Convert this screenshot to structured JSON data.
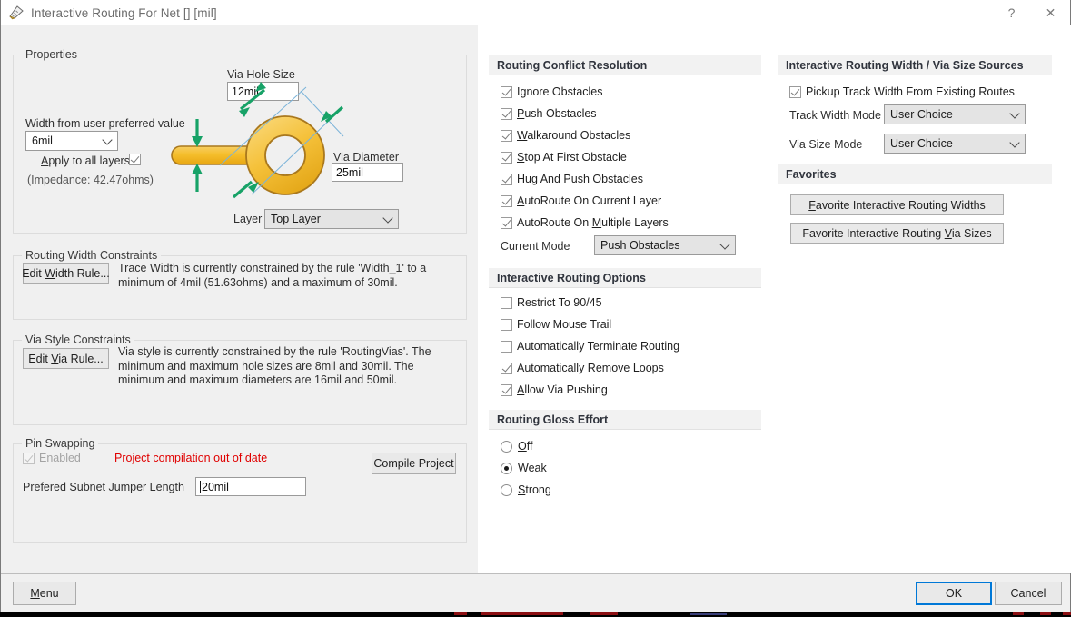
{
  "window": {
    "title": "Interactive Routing For Net [] [mil]",
    "icon": "routing-icon",
    "help_button": "?",
    "close_button": "✕"
  },
  "left_panel": {
    "properties": {
      "legend": "Properties",
      "via_hole_size_label": "Via Hole Size",
      "via_hole_size_value": "12mil",
      "width_label": "Width from user preferred value",
      "width_value": "6mil",
      "apply_all_layers_label": "Apply to all layers",
      "apply_all_layers_checked": true,
      "impedance_text": "(Impedance: 42.47ohms)",
      "via_diameter_label": "Via Diameter",
      "via_diameter_value": "25mil",
      "layer_label": "Layer",
      "layer_value": "Top Layer"
    },
    "routing_width_constraints": {
      "legend": "Routing Width Constraints",
      "edit_button": "Edit Width Rule...",
      "description": "Trace Width is currently constrained by the rule 'Width_1' to a minimum of 4mil (51.63ohms) and a maximum of 30mil."
    },
    "via_style_constraints": {
      "legend": "Via Style Constraints",
      "edit_button": "Edit Via Rule...",
      "description": "Via style is currently constrained by the rule 'RoutingVias'. The minimum and maximum hole sizes are 8mil and 30mil. The minimum and maximum diameters are 16mil and 50mil."
    },
    "pin_swapping": {
      "legend": "Pin Swapping",
      "enabled_label": "Enabled",
      "enabled_checked": true,
      "enabled_disabled": true,
      "warning_text": "Project compilation out of date",
      "compile_button": "Compile Project",
      "jumper_length_label": "Prefered Subnet Jumper Length",
      "jumper_length_value": "20mil"
    }
  },
  "middle_panel": {
    "conflict_resolution": {
      "header": "Routing Conflict Resolution",
      "options": [
        {
          "label": "Ignore Obstacles",
          "checked": true
        },
        {
          "label": "Push Obstacles",
          "checked": true
        },
        {
          "label": "Walkaround Obstacles",
          "checked": true
        },
        {
          "label": "Stop At First Obstacle",
          "checked": true
        },
        {
          "label": "Hug And Push Obstacles",
          "checked": true
        },
        {
          "label": "AutoRoute On Current Layer",
          "checked": true
        },
        {
          "label": "AutoRoute On Multiple Layers",
          "checked": true
        }
      ],
      "current_mode_label": "Current Mode",
      "current_mode_value": "Push Obstacles"
    },
    "routing_options": {
      "header": "Interactive Routing Options",
      "options": [
        {
          "label": "Restrict To 90/45",
          "checked": false
        },
        {
          "label": "Follow Mouse Trail",
          "checked": false
        },
        {
          "label": "Automatically Terminate Routing",
          "checked": false
        },
        {
          "label": "Automatically Remove Loops",
          "checked": true
        },
        {
          "label": "Allow Via Pushing",
          "checked": true
        }
      ]
    },
    "gloss_effort": {
      "header": "Routing Gloss Effort",
      "options": [
        {
          "label": "Off",
          "selected": false
        },
        {
          "label": "Weak",
          "selected": true
        },
        {
          "label": "Strong",
          "selected": false
        }
      ]
    }
  },
  "right_panel": {
    "width_via_sources": {
      "header": "Interactive Routing Width / Via Size Sources",
      "pickup_label": "Pickup Track Width From Existing Routes",
      "pickup_checked": true,
      "track_width_mode_label": "Track Width Mode",
      "track_width_mode_value": "User Choice",
      "via_size_mode_label": "Via Size Mode",
      "via_size_mode_value": "User Choice"
    },
    "favorites": {
      "header": "Favorites",
      "widths_button": "Favorite Interactive Routing Widths",
      "via_sizes_button": "Favorite Interactive Routing Via Sizes"
    }
  },
  "footer": {
    "menu_button": "Menu",
    "ok_button": "OK",
    "cancel_button": "Cancel"
  },
  "colors": {
    "dialog_bg": "#ffffff",
    "panel_bg": "#f0f0f0",
    "section_header_bg": "#f2f2f2",
    "accent_focus": "#0078d7",
    "warning_red": "#e00000",
    "copper_gold": "#f5c13a",
    "copper_edge": "#a9781e",
    "annotation_green": "#17a267",
    "leader_blue": "#7ab3d9"
  }
}
